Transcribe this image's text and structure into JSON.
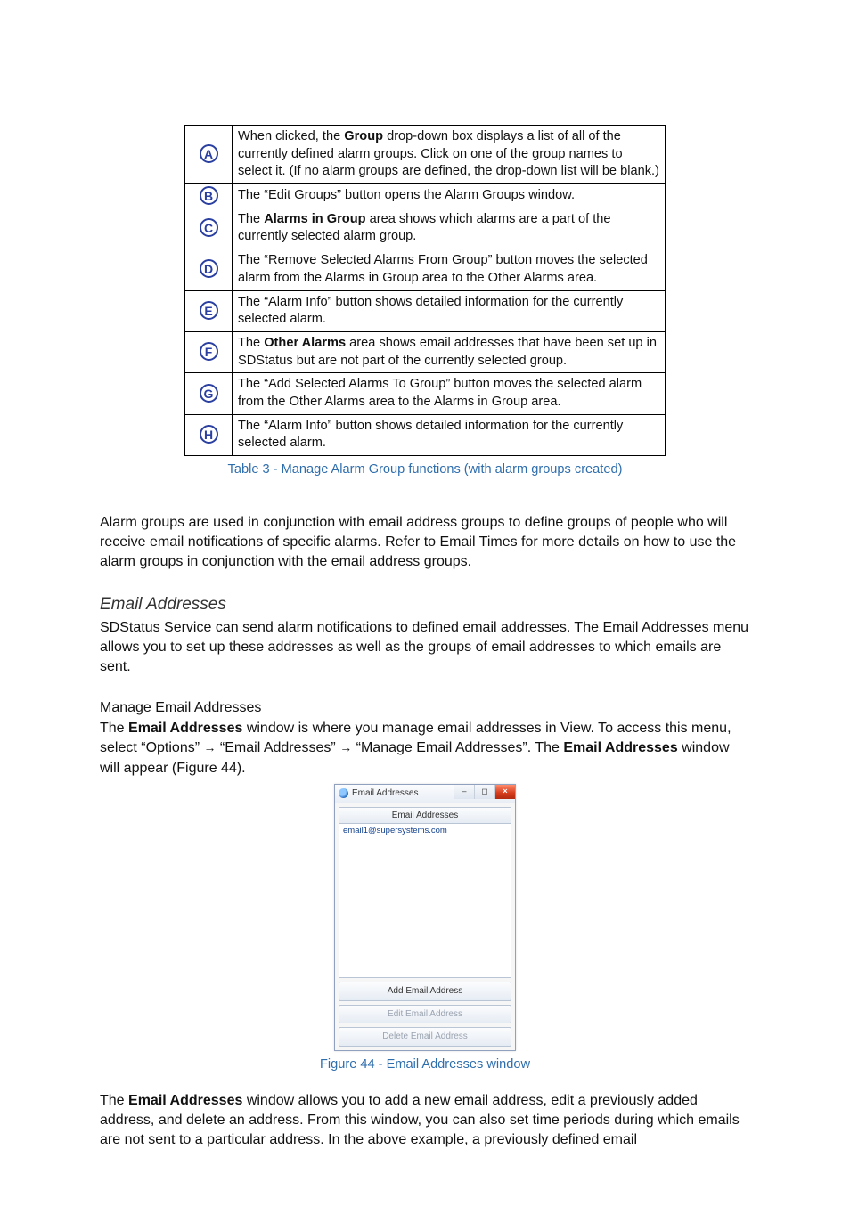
{
  "table": {
    "rows": [
      {
        "letter": "A",
        "html": "When clicked, the <span class='b'>Group</span> drop-down box displays a list of all of the currently defined alarm groups. Click on one of the group names to select it. (If no alarm groups are defined, the drop-down list will be blank.)"
      },
      {
        "letter": "B",
        "html": "The “Edit Groups” button opens the Alarm Groups window."
      },
      {
        "letter": "C",
        "html": "The <span class='b'>Alarms in Group</span> area shows  which alarms are a part of the currently selected alarm group."
      },
      {
        "letter": "D",
        "html": "The “Remove Selected Alarms From Group” button  moves the selected alarm from the Alarms in Group area to the Other Alarms area."
      },
      {
        "letter": "E",
        "html": "The “Alarm Info” button shows detailed information for the currently selected alarm."
      },
      {
        "letter": "F",
        "html": "The <span class='b'>Other Alarms</span> area shows email addresses that have been set up in SDStatus but are not part of the currently selected group."
      },
      {
        "letter": "G",
        "html": "The “Add Selected Alarms To Group” button moves the selected alarm from the Other Alarms area to the Alarms in Group area."
      },
      {
        "letter": "H",
        "html": "The “Alarm Info” button shows detailed information for the currently selected alarm."
      }
    ],
    "caption": "Table 3 - Manage Alarm Group functions (with alarm groups created)"
  },
  "para1": "Alarm groups are used in conjunction with email address groups to define groups of people who will receive email notifications of specific alarms. Refer to Email Times for more details on how to use the alarm groups in conjunction with the email address groups.",
  "section_heading": "Email Addresses",
  "para2": "SDStatus Service can send alarm notifications to defined email addresses. The Email Addresses menu allows you to set up these addresses as well as the groups of email addresses to which emails are sent.",
  "subheading": "Manage Email Addresses",
  "para3_html": "The <span class='b'>Email Addresses</span> window is where you manage email addresses in View. To access this menu, select “Options” <span class='arrow'>→</span> “Email Addresses” <span class='arrow'>→</span> “Manage Email Addresses”. The <span class='b'>Email Addresses</span> window will appear (Figure 44).",
  "window": {
    "title": "Email Addresses",
    "list_header": "Email Addresses",
    "list_items": [
      "email1@supersystems.com"
    ],
    "buttons": [
      {
        "label": "Add Email Address",
        "enabled": true
      },
      {
        "label": "Edit Email Address",
        "enabled": false
      },
      {
        "label": "Delete Email Address",
        "enabled": false
      }
    ]
  },
  "figure_caption": "Figure 44 - Email Addresses window",
  "para4_html": "The <span class='b'>Email Addresses</span> window allows you to add a new email address, edit a previously added address, and delete an address. From this window, you can also set time periods during which emails are not sent to a particular address. In the above example, a previously defined email"
}
